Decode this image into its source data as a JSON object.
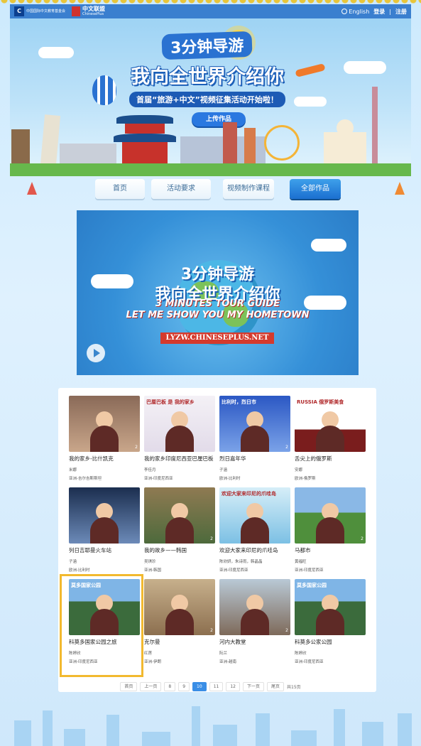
{
  "header": {
    "logo1_text": "中国国际中文教育基金会",
    "logo2_title": "中文联盟",
    "logo2_sub": "ChinesePlus",
    "lang_label": "English",
    "login": "登录",
    "register": "注册"
  },
  "hero": {
    "title_line1": "3分钟导游",
    "title_line2": "我向全世界介绍你",
    "subtitle": "首届“旅游+中文”视频征集活动开始啦！",
    "upload_button": "上传作品"
  },
  "nav": {
    "items": [
      "首页",
      "活动要求",
      "视频制作课程",
      "全部作品"
    ],
    "active_index": 3
  },
  "video": {
    "title_cn_1": "3分钟导游",
    "title_cn_2": "我向全世界介绍你",
    "title_en_1": "3 MINUTES TOUR GUIDE",
    "title_en_2": "LET ME SHOW YOU MY HOMETOWN",
    "url": "LYZW.CHINESEPLUS.NET"
  },
  "works": [
    {
      "title": "我的家乡-比什凯克",
      "author": "米娜",
      "region": "亚洲-吉尔吉斯斯坦",
      "count": "2",
      "thumb_text": ""
    },
    {
      "title": "我的家乡印度尼西亚巴厘巴板",
      "author": "李佳月",
      "region": "亚洲-印度尼西亚",
      "count": "",
      "thumb_text": "巴厘巴板 是 我的家乡"
    },
    {
      "title": "烈日嘉年华",
      "author": "子涵",
      "region": "欧洲-比利时",
      "count": "2",
      "thumb_text": "比利时，烈日市"
    },
    {
      "title": "舌尖上的俄罗斯",
      "author": "安娜",
      "region": "欧洲-俄罗斯",
      "count": "",
      "thumb_text": "RUSSIA 俄罗斯美食"
    },
    {
      "title": "列日吉耶曼火车站",
      "author": "子涵",
      "region": "欧洲-比利时",
      "count": "",
      "thumb_text": ""
    },
    {
      "title": "我的故乡——韩国",
      "author": "吴琪珍",
      "region": "亚洲-韩国",
      "count": "2",
      "thumb_text": ""
    },
    {
      "title": "欢迎大家来印尼的爪哇岛",
      "author": "陈欣妍，朱诗雨，韩晶晶",
      "region": "亚洲-印度尼西亚",
      "count": "",
      "thumb_text": "欢迎大家来印尼的爪哇岛"
    },
    {
      "title": "马都市",
      "author": "黄福旺",
      "region": "亚洲-印度尼西亚",
      "count": "2",
      "thumb_text": ""
    },
    {
      "title": "科莫多国家公园之旅",
      "author": "陈婷欣",
      "region": "亚洲-印度尼西亚",
      "count": "",
      "thumb_text": "莫多国家公园"
    },
    {
      "title": "克尔曼",
      "author": "红莲",
      "region": "亚洲-伊朗",
      "count": "2",
      "thumb_text": ""
    },
    {
      "title": "河内大教堂",
      "author": "阮兰",
      "region": "亚洲-越南",
      "count": "2",
      "thumb_text": ""
    },
    {
      "title": "科莫多公家公园",
      "author": "陈婷欣",
      "region": "亚洲-印度尼西亚",
      "count": "",
      "thumb_text": "莫多国家公园"
    }
  ],
  "pagination": {
    "first": "首页",
    "prev": "上一页",
    "pages": [
      "8",
      "9",
      "10",
      "11",
      "12"
    ],
    "current": "10",
    "next": "下一页",
    "last": "尾页",
    "total": "共15页"
  },
  "colors": {
    "accent": "#2a78e0",
    "highlight": "#f2b92f",
    "header_bg": "#3a7fcf"
  }
}
